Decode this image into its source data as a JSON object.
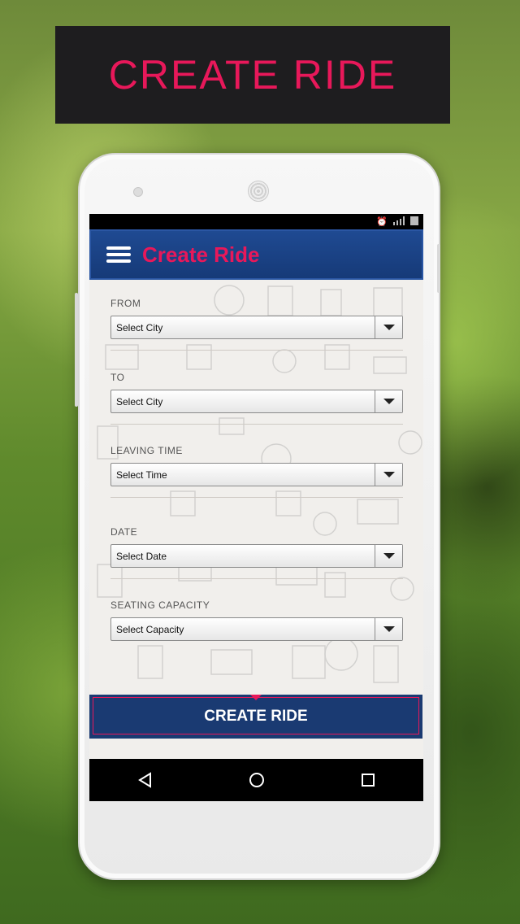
{
  "banner": {
    "title": "CREATE RIDE"
  },
  "appbar": {
    "title": "Create Ride"
  },
  "form": {
    "from": {
      "label": "FROM",
      "value": "Select City"
    },
    "to": {
      "label": "TO",
      "value": "Select City"
    },
    "leaving_time": {
      "label": "LEAVING TIME",
      "value": "Select Time"
    },
    "date": {
      "label": "DATE",
      "value": "Select Date"
    },
    "seating_capacity": {
      "label": "SEATING CAPACITY",
      "value": "Select Capacity"
    }
  },
  "actions": {
    "create_label": "CREATE RIDE"
  },
  "colors": {
    "accent": "#e8185a",
    "appbar": "#1f4a92",
    "button": "#1a3a72"
  },
  "icons": [
    "menu-icon",
    "alarm-icon",
    "signal-icon",
    "battery-icon",
    "back-icon",
    "home-icon",
    "recents-icon",
    "dropdown-arrow-icon"
  ]
}
